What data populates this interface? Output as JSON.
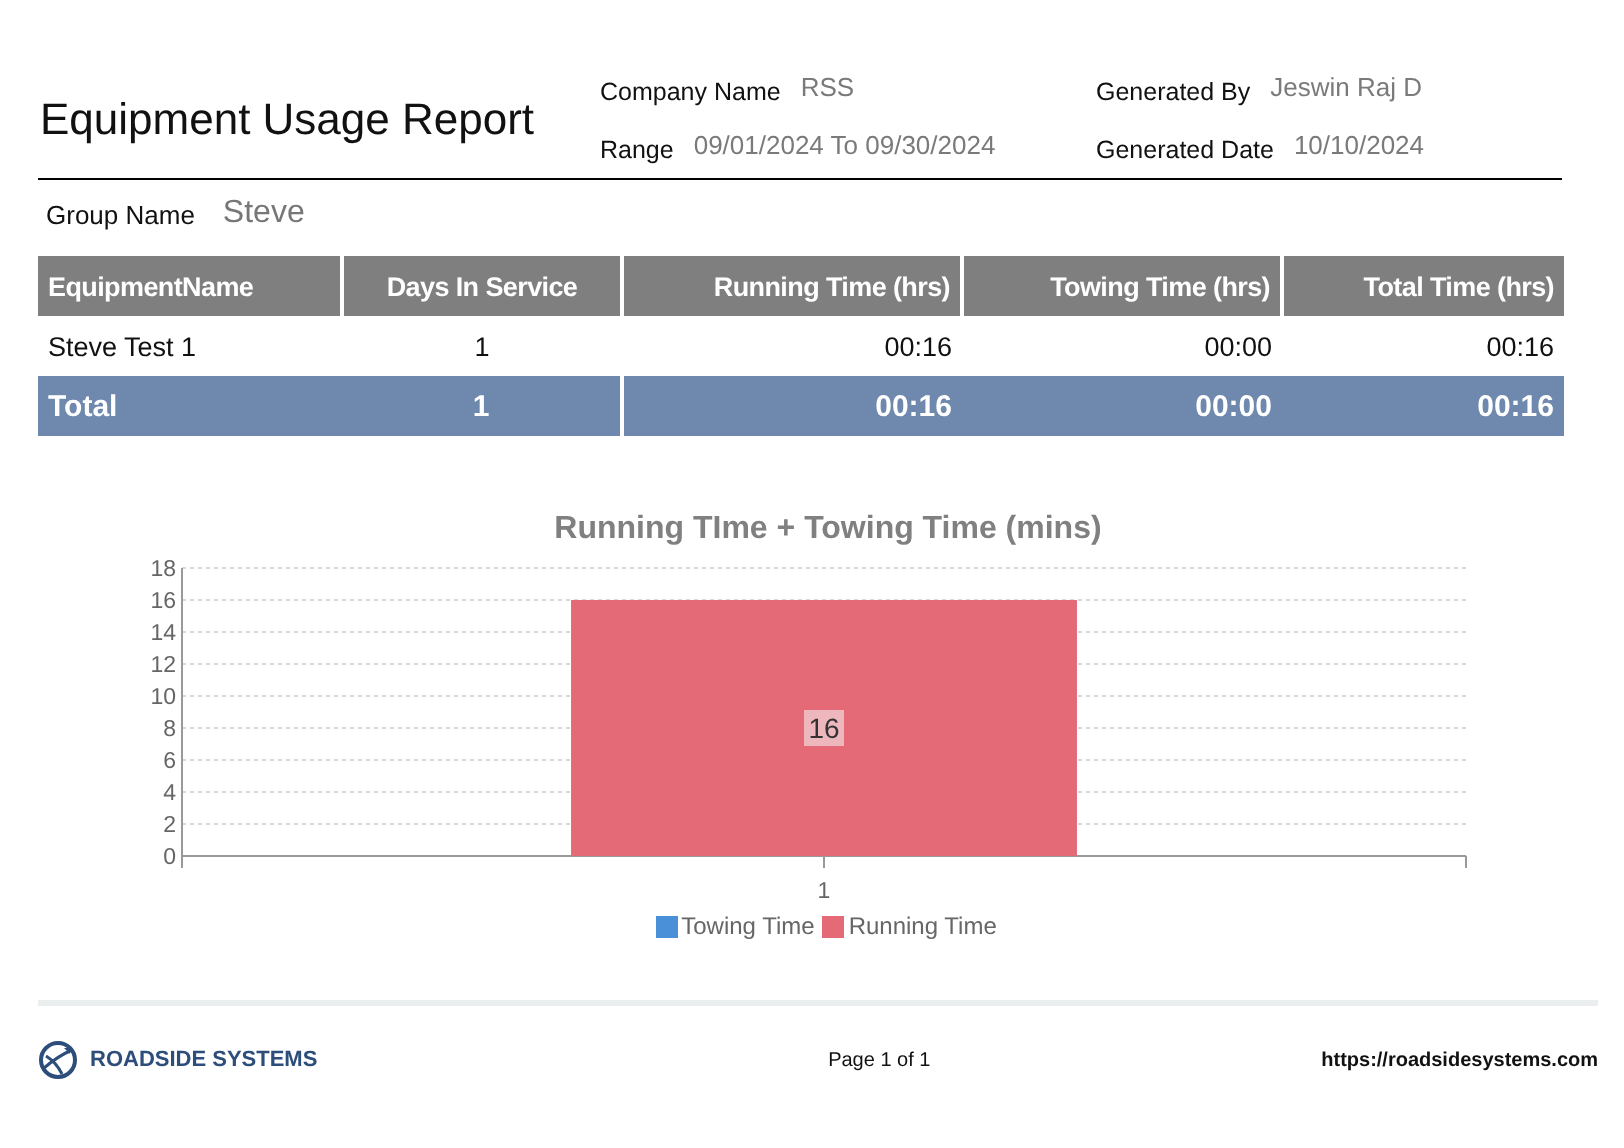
{
  "report": {
    "title": "Equipment Usage Report",
    "meta": [
      {
        "label": "Company Name",
        "value": "RSS"
      },
      {
        "label": "Generated By",
        "value": "Jeswin Raj D"
      },
      {
        "label": "Range",
        "value": "09/01/2024 To 09/30/2024"
      },
      {
        "label": "Generated Date",
        "value": "10/10/2024"
      }
    ],
    "group": {
      "label": "Group Name",
      "value": "Steve"
    }
  },
  "table": {
    "columns": [
      {
        "label": "EquipmentName"
      },
      {
        "label": "Days In Service"
      },
      {
        "label": "Running Time (hrs)"
      },
      {
        "label": "Towing Time (hrs)"
      },
      {
        "label": "Total Time (hrs)"
      }
    ],
    "rows": [
      [
        "Steve Test 1",
        "1",
        "00:16",
        "00:00",
        "00:16"
      ]
    ],
    "total": [
      "Total",
      "1",
      "00:16",
      "00:00",
      "00:16"
    ]
  },
  "chart": {
    "chart_data": {
      "type": "bar",
      "title": "Running TIme + Towing Time (mins)",
      "categories": [
        "1"
      ],
      "stacked": true,
      "grid": true,
      "value_labels": [
        [
          null
        ],
        [
          "16"
        ]
      ],
      "ylim": [
        0,
        18
      ],
      "yticks": [
        0,
        2,
        4,
        6,
        8,
        10,
        12,
        14,
        16,
        18
      ],
      "series": [
        {
          "name": "Towing Time",
          "color": "#4a90d9",
          "values": [
            0
          ]
        },
        {
          "name": "Running Time",
          "color": "#e46a78",
          "values": [
            16
          ]
        }
      ]
    }
  },
  "footer": {
    "brand": "ROADSIDE SYSTEMS",
    "page": "Page 1 of 1",
    "url": "https://roadsidesystems.com"
  }
}
